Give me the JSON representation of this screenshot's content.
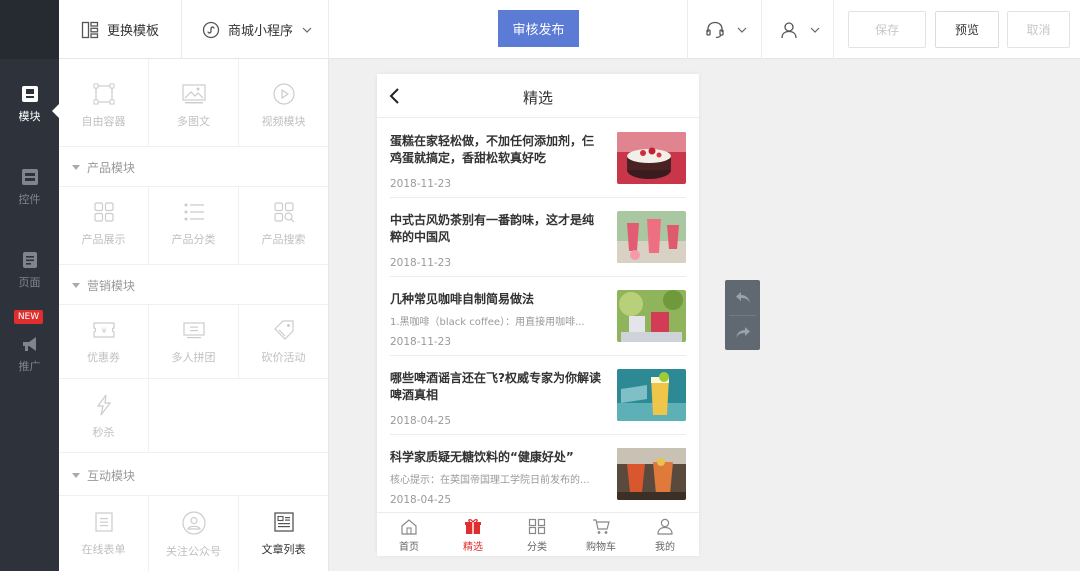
{
  "leftbar": {
    "items": [
      {
        "label": "模块",
        "icon": "module-icon",
        "active": true
      },
      {
        "label": "控件",
        "icon": "widget-icon",
        "active": false
      },
      {
        "label": "页面",
        "icon": "page-icon",
        "active": false
      },
      {
        "label": "推广",
        "icon": "megaphone-icon",
        "active": false
      }
    ],
    "new_badge": "NEW"
  },
  "topbar": {
    "change_template": "更换模板",
    "mini_program": "商城小程序",
    "publish": "审核发布",
    "save": "保存",
    "preview": "预览",
    "cancel": "取消"
  },
  "panel": {
    "top_items": [
      "自由容器",
      "多图文",
      "视频模块"
    ],
    "sections": [
      {
        "title": "产品模块",
        "items": [
          "产品展示",
          "产品分类",
          "产品搜索"
        ]
      },
      {
        "title": "营销模块",
        "items": [
          "优惠券",
          "多人拼团",
          "砍价活动",
          "秒杀"
        ]
      },
      {
        "title": "互动模块",
        "items": [
          "在线表单",
          "关注公众号",
          "文章列表"
        ]
      }
    ]
  },
  "phone": {
    "title": "精选",
    "articles": [
      {
        "title": "蛋糕在家轻松做，不加任何添加剂，仨鸡蛋就搞定，香甜松软真好吃",
        "desc": "",
        "date": "2018-11-23",
        "thumb": "cake"
      },
      {
        "title": "中式古风奶茶别有一番韵味，这才是纯粹的中国风",
        "desc": "",
        "date": "2018-11-23",
        "thumb": "tea"
      },
      {
        "title": "几种常见咖啡自制简易做法",
        "desc": "1.黑咖啡（black coffee）：用直接用咖啡...",
        "date": "2018-11-23",
        "thumb": "coffee"
      },
      {
        "title": "哪些啤酒谣言还在飞?权威专家为你解读啤酒真相",
        "desc": "",
        "date": "2018-04-25",
        "thumb": "beer"
      },
      {
        "title": "科学家质疑无糖饮料的“健康好处”",
        "desc": "核心提示：在英国帝国理工学院日前发布的...",
        "date": "2018-04-25",
        "thumb": "drink"
      }
    ],
    "tabs": [
      {
        "label": "首页",
        "icon": "home-icon",
        "active": false
      },
      {
        "label": "精选",
        "icon": "gift-icon",
        "active": true
      },
      {
        "label": "分类",
        "icon": "category-icon",
        "active": false
      },
      {
        "label": "购物车",
        "icon": "cart-icon",
        "active": false
      },
      {
        "label": "我的",
        "icon": "user-icon",
        "active": false
      }
    ]
  },
  "colors": {
    "accent": "#5b7bd5",
    "sidebar": "#2e333b",
    "active_tab": "#e02e2e"
  }
}
